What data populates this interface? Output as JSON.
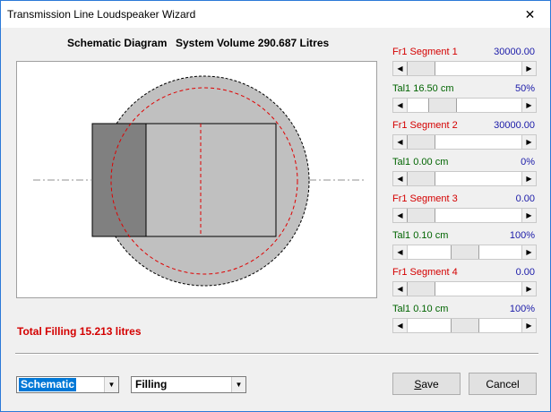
{
  "window": {
    "title": "Transmission Line Loudspeaker Wizard",
    "close_glyph": "✕"
  },
  "heading": {
    "label": "Schematic Diagram",
    "volume": "System Volume 290.687 Litres"
  },
  "total_filling": "Total Filling  15.213 litres",
  "segments": [
    {
      "name": "Fr1  Segment 1",
      "name_color": "red",
      "value": "30000.00",
      "value_color": "blue",
      "thumb": 0.0
    },
    {
      "name": "Tal1  16.50 cm",
      "name_color": "green",
      "value": "50%",
      "value_color": "blue",
      "thumb": 0.25
    },
    {
      "name": "Fr1  Segment 2",
      "name_color": "red",
      "value": "30000.00",
      "value_color": "blue",
      "thumb": 0.0
    },
    {
      "name": "Tal1  0.00 cm",
      "name_color": "green",
      "value": "0%",
      "value_color": "blue",
      "thumb": 0.0
    },
    {
      "name": "Fr1  Segment 3",
      "name_color": "red",
      "value": "0.00",
      "value_color": "blue",
      "thumb": 0.0
    },
    {
      "name": "Tal1  0.10 cm",
      "name_color": "green",
      "value": "100%",
      "value_color": "blue",
      "thumb": 0.5
    },
    {
      "name": "Fr1  Segment 4",
      "name_color": "red",
      "value": "0.00",
      "value_color": "blue",
      "thumb": 0.0
    },
    {
      "name": "Tal1  0.10 cm",
      "name_color": "green",
      "value": "100%",
      "value_color": "blue",
      "thumb": 0.5
    }
  ],
  "view_select": {
    "value": "Schematic"
  },
  "mode_select": {
    "value": "Filling"
  },
  "buttons": {
    "save": "Save",
    "cancel": "Cancel"
  }
}
